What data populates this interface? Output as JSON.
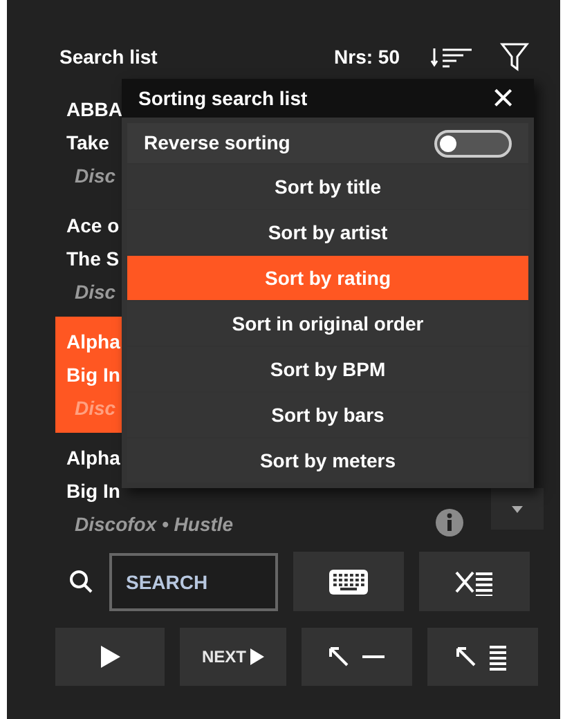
{
  "header": {
    "title": "Search list",
    "count": "Nrs: 50"
  },
  "rows": [
    {
      "artist": "ABBA",
      "title": "Take",
      "genre": "Disc",
      "selected": false
    },
    {
      "artist": "Ace o",
      "title": "The S",
      "genre": "Disc",
      "selected": false
    },
    {
      "artist": "Alpha",
      "title": "Big In",
      "genre": "Disc",
      "selected": true
    },
    {
      "artist": "Alpha",
      "title": "Big In",
      "genre": "Discofox • Hustle",
      "selected": false
    }
  ],
  "dialog": {
    "title": "Sorting search list",
    "close": "×",
    "toggle": {
      "label": "Reverse sorting",
      "on": false
    },
    "options": [
      {
        "label": "Sort by title",
        "selected": false
      },
      {
        "label": "Sort by artist",
        "selected": false
      },
      {
        "label": "Sort by rating",
        "selected": true
      },
      {
        "label": "Sort in original order",
        "selected": false
      },
      {
        "label": "Sort by BPM",
        "selected": false
      },
      {
        "label": "Sort by bars",
        "selected": false
      },
      {
        "label": "Sort by meters",
        "selected": false
      }
    ]
  },
  "search": {
    "placeholder": "SEARCH"
  },
  "next": {
    "label": "NEXT"
  }
}
